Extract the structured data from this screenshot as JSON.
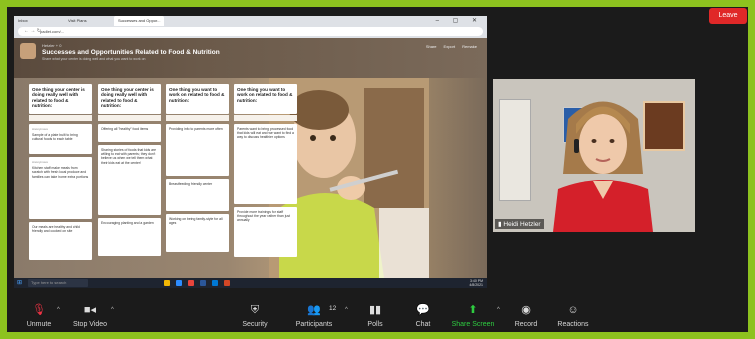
{
  "browser": {
    "tabs": [
      "Inbox",
      "Visit Plans",
      "Successes and Oppor..."
    ],
    "url": "padlet.com/..."
  },
  "padlet": {
    "author": "Hetzler + 0",
    "title": "Successes and Opportunities Related to Food & Nutrition",
    "subtitle": "Share what your center is doing well and what you want to work on",
    "actions": [
      "Share",
      "Export",
      "Remake"
    ]
  },
  "columns": [
    {
      "title": "One thing your center is doing really well with related to food & nutrition:",
      "posts": [
        {
          "text": "Sample of a plate built to bring cultural foods to each table"
        },
        {
          "text": "Kitchen staff make meals from scratch with fresh local produce and families can take home extra portions"
        },
        {
          "text": "Our meals are healthy and child friendly and cooked on site"
        }
      ]
    },
    {
      "title": "One thing your center is doing really well with related to food & nutrition:",
      "posts": [
        {
          "text": "Offering all \"healthy\" food items"
        },
        {
          "text": "Sharing stories of foods that kids are willing to eat with parents; they don't believe us when we tell them what their kids eat at the center!"
        },
        {
          "text": "Encouraging planting and a garden"
        }
      ]
    },
    {
      "title": "One thing you want to work on related to food & nutrition:",
      "posts": [
        {
          "text": "Providing info to parents more often"
        },
        {
          "text": "Breastfeeding friendly center"
        },
        {
          "text": "Working on being family-style for all ages"
        }
      ]
    },
    {
      "title": "One thing you want to work on related to food & nutrition:",
      "posts": [
        {
          "text": "Parents want to bring processed food that kids will eat and we want to find a way to discuss healthier options"
        },
        {
          "text": "Provide more trainings for staff throughout the year rather than just annually"
        }
      ]
    }
  ],
  "taskbar": {
    "search_placeholder": "Type here to search",
    "time": "3:40 PM",
    "date": "4/8/2021"
  },
  "participant": {
    "name": "Heidi Hetzler"
  },
  "toolbar": {
    "unmute": "Unmute",
    "stop_video": "Stop Video",
    "security": "Security",
    "participants": "Participants",
    "participants_count": "12",
    "polls": "Polls",
    "chat": "Chat",
    "share_screen": "Share Screen",
    "record": "Record",
    "reactions": "Reactions",
    "leave": "Leave"
  },
  "colors": {
    "background": "#8dc21f",
    "leave": "#e02828",
    "share_green": "#2ecc40"
  }
}
